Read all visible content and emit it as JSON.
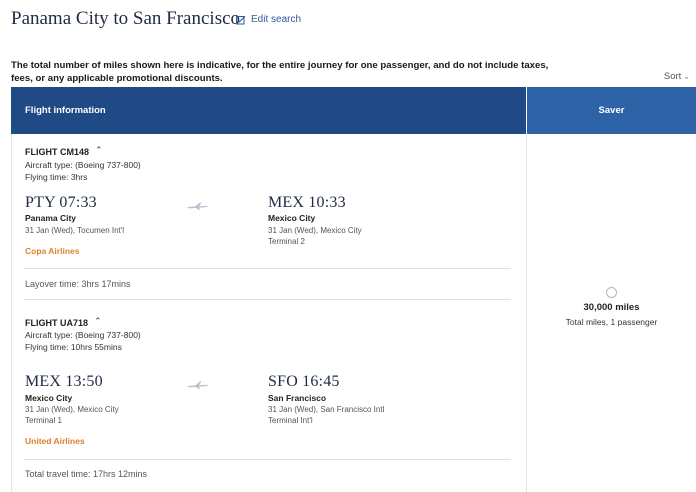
{
  "header": {
    "route_title": "Panama City to San Francisco",
    "edit_search_label": "Edit search"
  },
  "disclaimer": "The total number of miles shown here is indicative, for the entire journey for one passenger, and do not include taxes, fees, or any applicable promotional discounts.",
  "sort_label": "Sort",
  "table": {
    "col_flight_info": "Flight information",
    "col_fare": "Saver"
  },
  "segments": [
    {
      "flight_label": "FLIGHT CM148",
      "aircraft": "Aircraft type: (Boeing 737-800)",
      "flying_time": "Flying time: 3hrs",
      "dep_time": "PTY 07:33",
      "dep_city": "Panama City",
      "dep_detail1": "31 Jan (Wed), Tocumen Int'l",
      "arr_time": "MEX 10:33",
      "arr_city": "Mexico City",
      "arr_detail1": "31 Jan (Wed), Mexico City",
      "arr_detail2": "Terminal 2",
      "airline": "Copa Airlines"
    },
    {
      "flight_label": "FLIGHT UA718",
      "aircraft": "Aircraft type: (Boeing 737-800)",
      "flying_time": "Flying time: 10hrs 55mins",
      "dep_time": "MEX 13:50",
      "dep_city": "Mexico City",
      "dep_detail1": "31 Jan (Wed), Mexico City",
      "dep_detail2": "Terminal 1",
      "arr_time": "SFO 16:45",
      "arr_city": "San Francisco",
      "arr_detail1": "31 Jan (Wed), San Francisco Intl",
      "arr_detail2": "Terminal Int'l",
      "airline": "United Airlines"
    }
  ],
  "layover": "Layover time: 3hrs 17mins",
  "total_travel": "Total travel time: 17hrs 12mins",
  "fare": {
    "miles": "30,000 miles",
    "subtitle": "Total miles, 1 passenger"
  },
  "colors": {
    "header_dark": "#1f4a86",
    "header_fare": "#2d62a6",
    "airline_accent": "#d9822b",
    "title": "#1f2a44"
  },
  "icons": {
    "edit": "edit-icon",
    "plane": "plane-icon",
    "collapse": "chevron-up-icon",
    "sort_caret": "chevron-down-icon"
  }
}
